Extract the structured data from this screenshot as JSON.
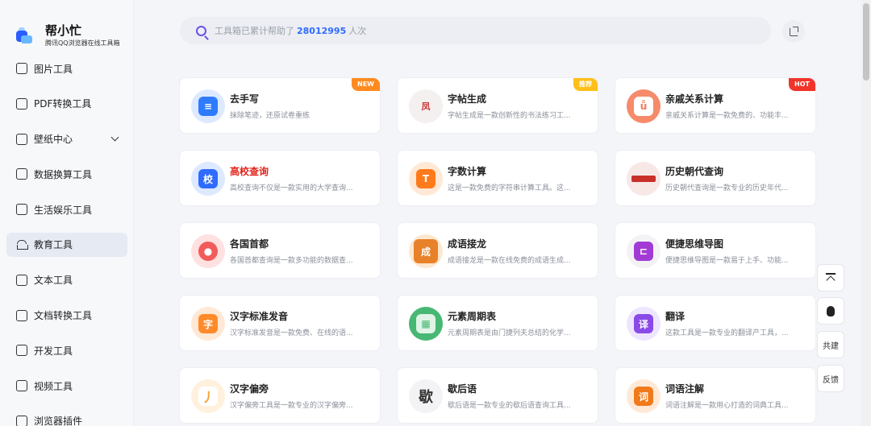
{
  "brand": {
    "title": "帮小忙",
    "subtitle": "腾讯QQ浏览器在线工具箱"
  },
  "sidebar": {
    "items": [
      {
        "label": "图片工具",
        "icon": "image-icon"
      },
      {
        "label": "PDF转换工具",
        "icon": "pdf-icon"
      },
      {
        "label": "壁纸中心",
        "icon": "wallpaper-icon",
        "expandable": true
      },
      {
        "label": "数据换算工具",
        "icon": "calculator-icon"
      },
      {
        "label": "生活娱乐工具",
        "icon": "entertainment-icon"
      },
      {
        "label": "教育工具",
        "icon": "education-icon",
        "active": true
      },
      {
        "label": "文本工具",
        "icon": "text-icon"
      },
      {
        "label": "文档转换工具",
        "icon": "document-icon"
      },
      {
        "label": "开发工具",
        "icon": "code-icon"
      },
      {
        "label": "视频工具",
        "icon": "video-icon"
      },
      {
        "label": "浏览器插件",
        "icon": "plugin-icon"
      }
    ]
  },
  "search": {
    "prefix": "工具箱已累计帮助了",
    "count": "28012995",
    "suffix": "人次"
  },
  "cards": [
    {
      "title": "去手写",
      "desc": "抹除笔迹，还原试卷重练",
      "badge": "NEW",
      "color": "#2f7bff",
      "glyph": ""
    },
    {
      "title": "字帖生成",
      "desc": "字帖生成是一款创新性的书法练习工...",
      "badge": "推荐",
      "color": "#d04a3a",
      "glyph": "凤"
    },
    {
      "title": "亲戚关系计算",
      "desc": "亲戚关系计算是一款免费的、功能丰...",
      "badge": "HOT",
      "color": "#f07a55",
      "glyph": ""
    },
    {
      "title": "高校查询",
      "desc": "高校查询不仅是一款实用的大学查询...",
      "badge": "",
      "color": "#2f6bff",
      "glyph": "校",
      "titleRed": true
    },
    {
      "title": "字数计算",
      "desc": "这是一款免费的字符串计算工具。这...",
      "badge": "",
      "color": "#ff7a1a",
      "glyph": "T"
    },
    {
      "title": "历史朝代查询",
      "desc": "历史朝代查询是一款专业的历史年代...",
      "badge": "",
      "color": "#c8302a",
      "glyph": ""
    },
    {
      "title": "各国首都",
      "desc": "各国首都查询是一款多功能的数据查...",
      "badge": "",
      "color": "#f25b5b",
      "glyph": ""
    },
    {
      "title": "成语接龙",
      "desc": "成语接龙是一款在线免费的成语生成...",
      "badge": "",
      "color": "#e7812a",
      "glyph": "成"
    },
    {
      "title": "便捷思维导图",
      "desc": "便捷思维导图是一款易于上手、功能...",
      "badge": "",
      "color": "#a23bd6",
      "glyph": ""
    },
    {
      "title": "汉字标准发音",
      "desc": "汉字标准发音是一款免费、在线的语...",
      "badge": "",
      "color": "#ff8a2a",
      "glyph": "字"
    },
    {
      "title": "元素周期表",
      "desc": "元素周期表是由门捷列夫总结的化学...",
      "badge": "",
      "color": "#46b873",
      "glyph": ""
    },
    {
      "title": "翻译",
      "desc": "这款工具是一款专业的翻译产工具，...",
      "badge": "",
      "color": "#8a4ae8",
      "glyph": "译"
    },
    {
      "title": "汉字偏旁",
      "desc": "汉字偏旁工具是一款专业的汉字偏旁...",
      "badge": "",
      "color": "#f3a53a",
      "glyph": "丿"
    },
    {
      "title": "歇后语",
      "desc": "歇后语是一款专业的歇后语查询工具...",
      "badge": "",
      "color": "#333333",
      "glyph": "歇"
    },
    {
      "title": "词语注解",
      "desc": "词语注解是一款用心打造的词典工具...",
      "badge": "",
      "color": "#f07a1a",
      "glyph": "词"
    }
  ],
  "float": {
    "build_label": "共建",
    "feedback_label": "反馈"
  }
}
